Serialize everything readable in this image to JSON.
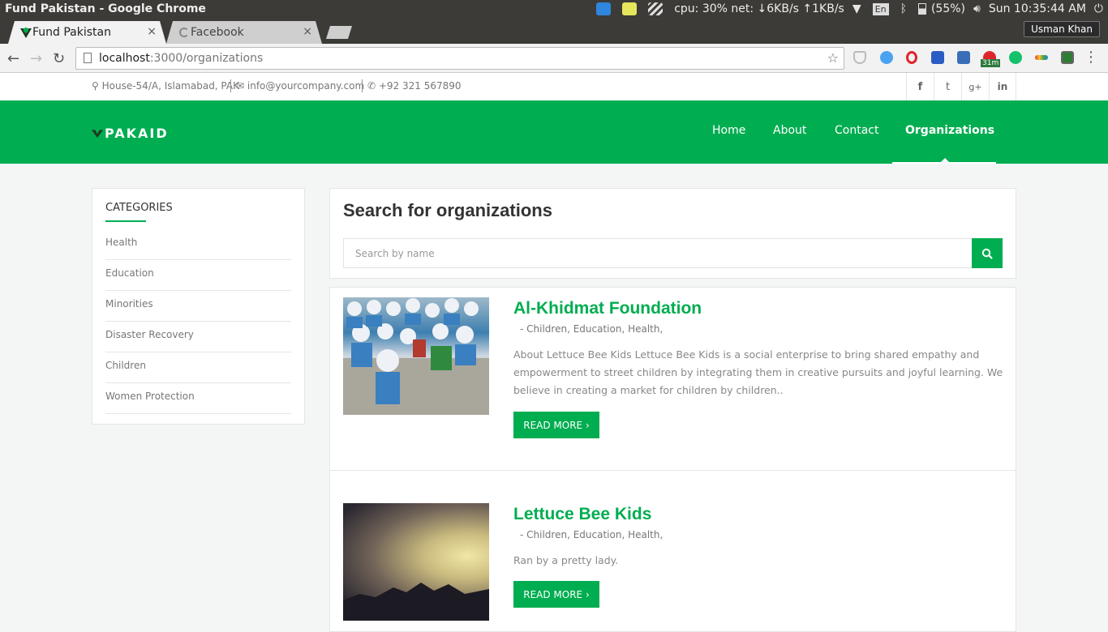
{
  "os": {
    "window_title": "Fund Pakistan - Google Chrome",
    "cpu_net": "cpu: 30% net: ↓6KB/s ↑1KB/s",
    "lang": "En",
    "battery": "(55%)",
    "clock": "Sun 10:35:44 AM"
  },
  "browser": {
    "tabs": [
      {
        "label": "Fund Pakistan"
      },
      {
        "label": "Facebook"
      }
    ],
    "close_glyph": "×",
    "user": "Usman Khan",
    "url_host": "localhost",
    "url_path": ":3000/organizations",
    "ext_badge": "31m"
  },
  "topinfo": {
    "address": "House-54/A, Islamabad, PAK",
    "email": "info@yourcompany.com",
    "phone": "+92 321 567890",
    "social": [
      "f",
      "t",
      "g+",
      "in"
    ]
  },
  "header": {
    "logo": "PAKAID",
    "nav": [
      "Home",
      "About",
      "Contact",
      "Organizations"
    ]
  },
  "sidebar": {
    "title": "CATEGORIES",
    "items": [
      "Health",
      "Education",
      "Minorities",
      "Disaster Recovery",
      "Children",
      "Women Protection"
    ]
  },
  "search": {
    "title": "Search for organizations",
    "placeholder": "Search by name"
  },
  "organizations": [
    {
      "name": "Al-Khidmat Foundation",
      "categories": "-    Children, Education, Health,",
      "description": "About Lettuce Bee Kids Lettuce Bee Kids is a social enterprise to bring shared empathy and empowerment to street children by integrating them in creative pursuits and joyful learning. We believe in creating a market for children by children..",
      "button": "READ MORE ›"
    },
    {
      "name": "Lettuce Bee Kids",
      "categories": "-    Children, Education, Health,",
      "description": "Ran by a pretty lady.",
      "button": "READ MORE ›"
    }
  ],
  "colors": {
    "brand_green": "#00ad50",
    "os_bar": "#3c3b37"
  }
}
